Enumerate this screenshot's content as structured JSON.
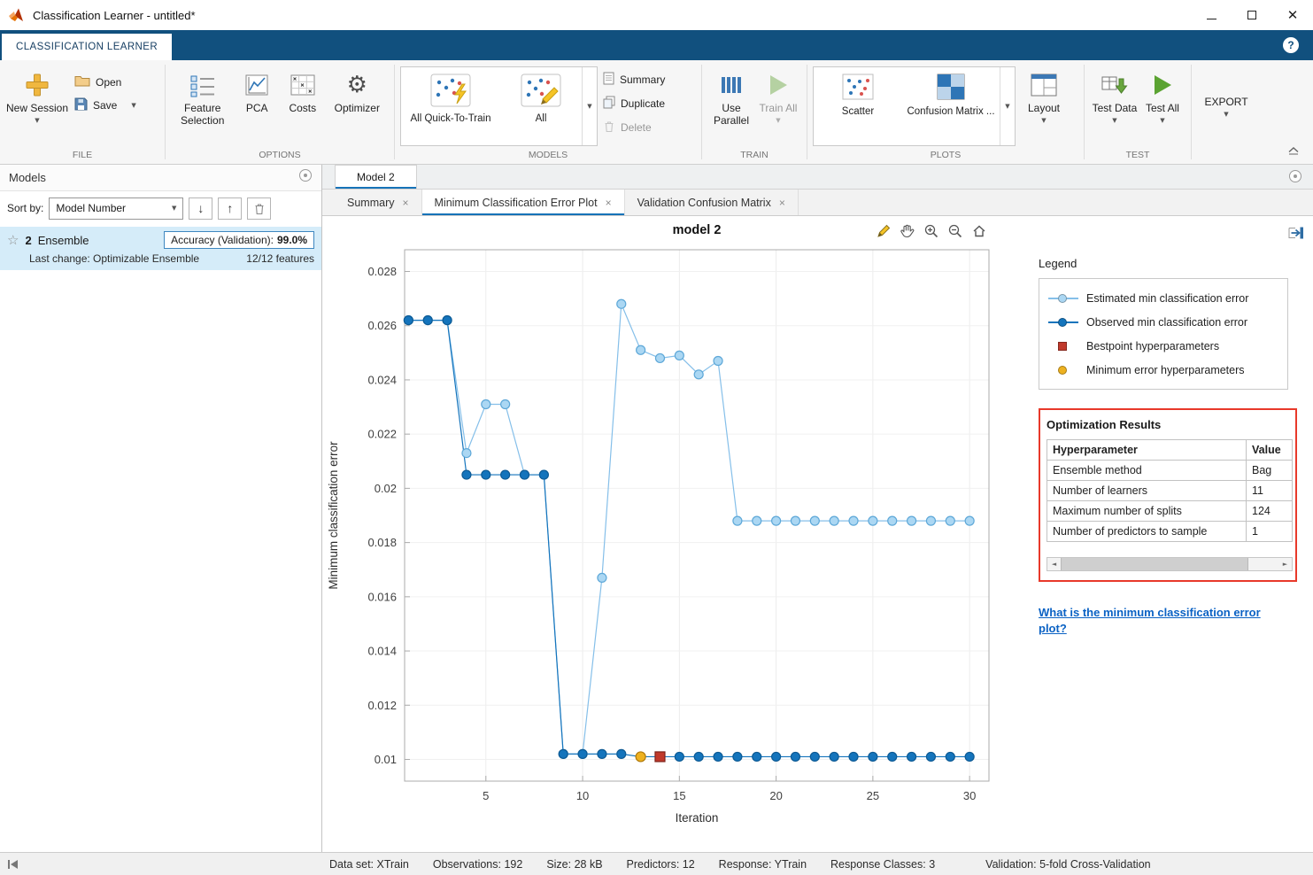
{
  "window": {
    "title": "Classification Learner - untitled*"
  },
  "ribbon": {
    "tab_label": "CLASSIFICATION LEARNER",
    "help": "?"
  },
  "toolbar": {
    "file": {
      "label": "FILE",
      "new_session": "New Session",
      "open": "Open",
      "save": "Save"
    },
    "options": {
      "label": "OPTIONS",
      "feature_selection": "Feature Selection",
      "pca": "PCA",
      "costs": "Costs",
      "optimizer": "Optimizer"
    },
    "models": {
      "label": "MODELS",
      "all_quick": "All Quick-To-Train",
      "all": "All",
      "summary": "Summary",
      "duplicate": "Duplicate",
      "delete": "Delete"
    },
    "train": {
      "label": "TRAIN",
      "use_parallel": "Use Parallel",
      "train_all": "Train All"
    },
    "plots": {
      "label": "PLOTS",
      "scatter": "Scatter",
      "confusion_matrix": "Confusion Matrix ...",
      "layout": "Layout"
    },
    "test": {
      "label": "TEST",
      "test_data": "Test Data",
      "test_all": "Test All"
    },
    "export_label": "EXPORT"
  },
  "models_panel": {
    "title": "Models",
    "sort_by_label": "Sort by:",
    "sort_value": "Model Number",
    "model": {
      "id": "2",
      "type": "Ensemble",
      "accuracy_label": "Accuracy (Validation):",
      "accuracy_value": "99.0%",
      "last_change": "Last change: Optimizable Ensemble",
      "features": "12/12 features"
    }
  },
  "document": {
    "tab": "Model 2",
    "subtabs": [
      "Summary",
      "Minimum Classification Error Plot",
      "Validation Confusion Matrix"
    ],
    "active_subtab": 1
  },
  "legend": {
    "title": "Legend",
    "items": [
      {
        "label": "Estimated min classification error",
        "marker": "circle",
        "color": "#abd7f3",
        "line": "#85bfe9"
      },
      {
        "label": "Observed min classification error",
        "marker": "circle",
        "color": "#1474bc",
        "line": "#1474bc"
      },
      {
        "label": "Bestpoint hyperparameters",
        "marker": "square",
        "color": "#c0392b"
      },
      {
        "label": "Minimum error hyperparameters",
        "marker": "circle",
        "color": "#edb120"
      }
    ]
  },
  "optimization_results": {
    "title": "Optimization Results",
    "columns": [
      "Hyperparameter",
      "Value"
    ],
    "rows": [
      [
        "Ensemble method",
        "Bag"
      ],
      [
        "Number of learners",
        "11"
      ],
      [
        "Maximum number of splits",
        "124"
      ],
      [
        "Number of predictors to sample",
        "1"
      ]
    ]
  },
  "help_link": "What is the minimum classification error plot?",
  "status_bar": {
    "items": [
      "Data set: XTrain",
      "Observations: 192",
      "Size: 28 kB",
      "Predictors: 12",
      "Response: YTrain",
      "Response Classes: 3",
      "Validation: 5-fold Cross-Validation"
    ]
  },
  "chart_data": {
    "type": "line",
    "title": "model 2",
    "xlabel": "Iteration",
    "ylabel": "Minimum classification error",
    "xlim": [
      0.8,
      31
    ],
    "ylim": [
      0.0092,
      0.0288
    ],
    "xticks": [
      5,
      10,
      15,
      20,
      25,
      30
    ],
    "yticks": [
      0.01,
      0.012,
      0.014,
      0.016,
      0.018,
      0.02,
      0.022,
      0.024,
      0.026,
      0.028
    ],
    "grid": true,
    "x": [
      1,
      2,
      3,
      4,
      5,
      6,
      7,
      8,
      9,
      10,
      11,
      12,
      13,
      14,
      15,
      16,
      17,
      18,
      19,
      20,
      21,
      22,
      23,
      24,
      25,
      26,
      27,
      28,
      29,
      30
    ],
    "series": [
      {
        "name": "Estimated min classification error",
        "line": "#85bfe9",
        "marker_fill": "#abd7f3",
        "marker_edge": "#5ea8d8",
        "values": [
          0.0262,
          0.0262,
          0.0262,
          0.0213,
          0.0231,
          0.0231,
          0.0205,
          0.0205,
          0.0102,
          0.0102,
          0.0167,
          0.0268,
          0.0251,
          0.0248,
          0.0249,
          0.0242,
          0.0247,
          0.0188,
          0.0188,
          0.0188,
          0.0188,
          0.0188,
          0.0188,
          0.0188,
          0.0188,
          0.0188,
          0.0188,
          0.0188,
          0.0188,
          0.0188
        ]
      },
      {
        "name": "Observed min classification error",
        "line": "#1474bc",
        "marker_fill": "#1474bc",
        "marker_edge": "#0d5a94",
        "values": [
          0.0262,
          0.0262,
          0.0262,
          0.0205,
          0.0205,
          0.0205,
          0.0205,
          0.0205,
          0.0102,
          0.0102,
          0.0102,
          0.0102,
          0.0101,
          0.0101,
          0.0101,
          0.0101,
          0.0101,
          0.0101,
          0.0101,
          0.0101,
          0.0101,
          0.0101,
          0.0101,
          0.0101,
          0.0101,
          0.0101,
          0.0101,
          0.0101,
          0.0101,
          0.0101
        ]
      }
    ],
    "points": [
      {
        "name": "Minimum error hyperparameters",
        "x": 13,
        "y": 0.0101,
        "marker": "circle",
        "color": "#edb120",
        "edge": "#b0790a"
      },
      {
        "name": "Bestpoint hyperparameters",
        "x": 14,
        "y": 0.0101,
        "marker": "square",
        "color": "#c0392b",
        "edge": "#7e231a"
      }
    ]
  }
}
